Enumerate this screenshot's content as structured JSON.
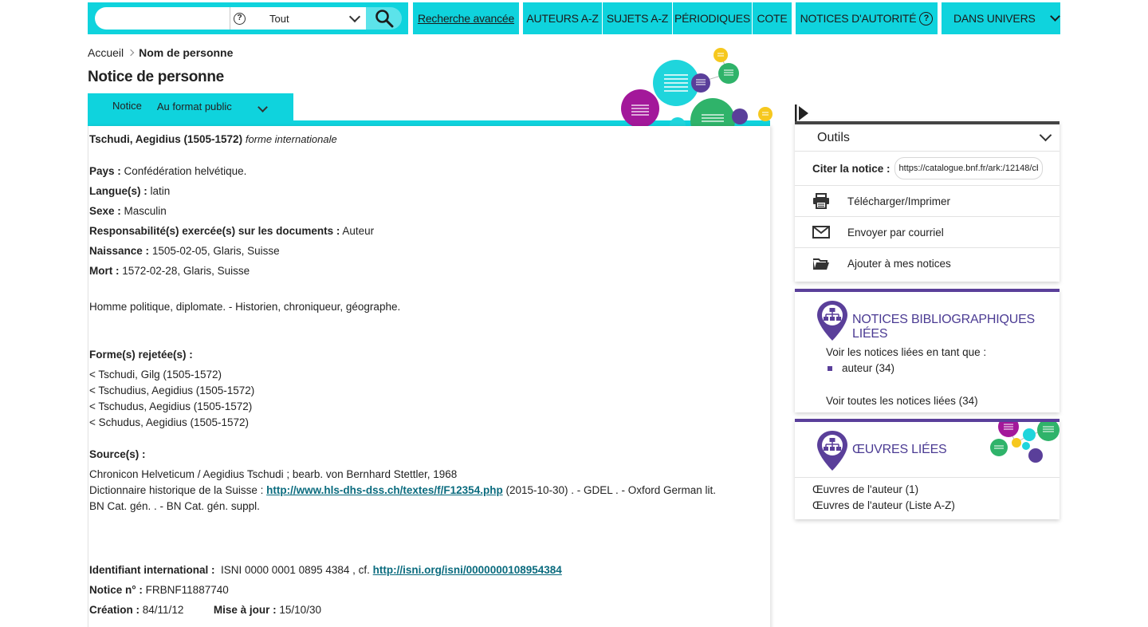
{
  "search": {
    "input_value": "",
    "scope_help": "?",
    "scope_value": "Tout"
  },
  "nav": {
    "advanced": "Recherche avancée",
    "auteurs": "AUTEURS A-Z",
    "sujets": "SUJETS A-Z",
    "periodiques": "PÉRIODIQUES",
    "cote": "COTE",
    "autorite": "NOTICES D'AUTORITÉ",
    "help": "?",
    "univers": "DANS UNIVERS"
  },
  "breadcrumb": {
    "home": "Accueil",
    "current": "Nom de personne"
  },
  "page_title": "Notice de personne",
  "format": {
    "label": "Notice",
    "value": "Au format public"
  },
  "record": {
    "name": "Tschudi, Aegidius (1505-1572)",
    "name_form": "forme internationale",
    "fields": [
      {
        "label": "Pays :",
        "value": "Confédération helvétique."
      },
      {
        "label": "Langue(s) :",
        "value": "latin"
      },
      {
        "label": "Sexe :",
        "value": "Masculin"
      },
      {
        "label": "Responsabilité(s) exercée(s) sur les documents :",
        "value": "Auteur"
      },
      {
        "label": "Naissance :",
        "value": "1505-02-05, Glaris, Suisse"
      },
      {
        "label": "Mort :",
        "value": "1572-02-28, Glaris, Suisse"
      }
    ],
    "note": "Homme politique, diplomate. - Historien, chroniqueur, géographe.",
    "rejected_heading": "Forme(s) rejetée(s) :",
    "rejected": [
      "< Tschudi, Gilg (1505-1572)",
      "< Tschudius, Aegidius (1505-1572)",
      "< Tschudus, Aegidius (1505-1572)",
      "< Schudus, Aegidius (1505-1572)"
    ],
    "sources_heading": "Source(s) :",
    "source_1": "Chronicon Helveticum / Aegidius Tschudi ; bearb. von Bernhard Stettler, 1968",
    "source_2_prefix": "Dictionnaire historique de la Suisse :",
    "source_2_link": "http://www.hls-dhs-dss.ch/textes/f/F12354.php",
    "source_2_suffix": "(2015-10-30) . - GDEL . - Oxford German lit.",
    "source_3": "BN Cat. gén. . - BN Cat. gén. suppl.",
    "isni_label": "Identifiant international :",
    "isni_value": "ISNI 0000 0001 0895 4384 , cf.",
    "isni_link": "http://isni.org/isni/0000000108954384",
    "notice_label": "Notice n° :",
    "notice_value": "FRBNF11887740",
    "creation_label": "Création :",
    "creation_value": "84/11/12",
    "maj_label": "Mise à jour :",
    "maj_value": "15/10/30"
  },
  "tools": {
    "title": "Outils",
    "cite_label": "Citer la notice :",
    "cite_value": "https://catalogue.bnf.fr/ark:/12148/cb",
    "download": "Télécharger/Imprimer",
    "email": "Envoyer par courriel",
    "add": "Ajouter à mes notices"
  },
  "biblio": {
    "title": "NOTICES BIBLIOGRAPHIQUES LIÉES",
    "intro": "Voir les notices liées en tant que :",
    "auteur": "auteur (34)",
    "all": "Voir toutes les notices liées (34)"
  },
  "oeuvres": {
    "title": "ŒUVRES LIÉES",
    "item1": "Œuvres de l'auteur (1)",
    "item2": "Œuvres de l'auteur (Liste A-Z)"
  },
  "colors": {
    "cyan": "#0fd3dd",
    "purple": "#5a3f9a",
    "link": "#0a6b7e",
    "magenta": "#a3189a",
    "green": "#2fb36a",
    "yellow": "#f6c81e"
  }
}
